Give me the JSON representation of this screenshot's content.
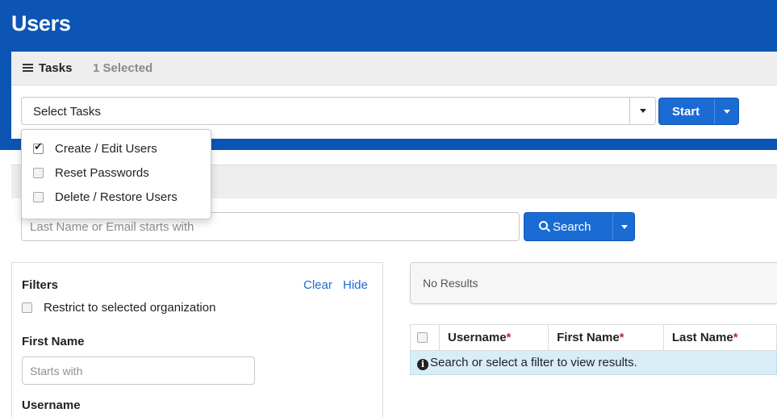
{
  "header": {
    "title": "Users"
  },
  "tasks": {
    "label": "Tasks",
    "selected_count": "1 Selected",
    "select_placeholder": "Select Tasks",
    "start_label": "Start",
    "menu": [
      {
        "label": "Create / Edit Users",
        "checked": true
      },
      {
        "label": "Reset Passwords",
        "checked": false
      },
      {
        "label": "Delete / Restore Users",
        "checked": false
      }
    ]
  },
  "search": {
    "placeholder": "Last Name or Email starts with",
    "button_label": "Search"
  },
  "filters": {
    "title": "Filters",
    "clear_label": "Clear",
    "hide_label": "Hide",
    "restrict_label": "Restrict to selected organization",
    "first_name_label": "First Name",
    "first_name_placeholder": "Starts with",
    "username_label": "Username"
  },
  "results": {
    "status": "No Results",
    "columns": [
      {
        "label": "Username",
        "required_mark": "*"
      },
      {
        "label": "First Name",
        "required_mark": "*"
      },
      {
        "label": "Last Name",
        "required_mark": "*"
      }
    ],
    "info_message": "Search or select a filter to view results."
  },
  "colors": {
    "header_bg": "#0d55b5",
    "primary_button": "#1a6bd4",
    "link": "#1a6bd4",
    "info_row_bg": "#d9edf7",
    "required_mark": "#c0262d"
  }
}
